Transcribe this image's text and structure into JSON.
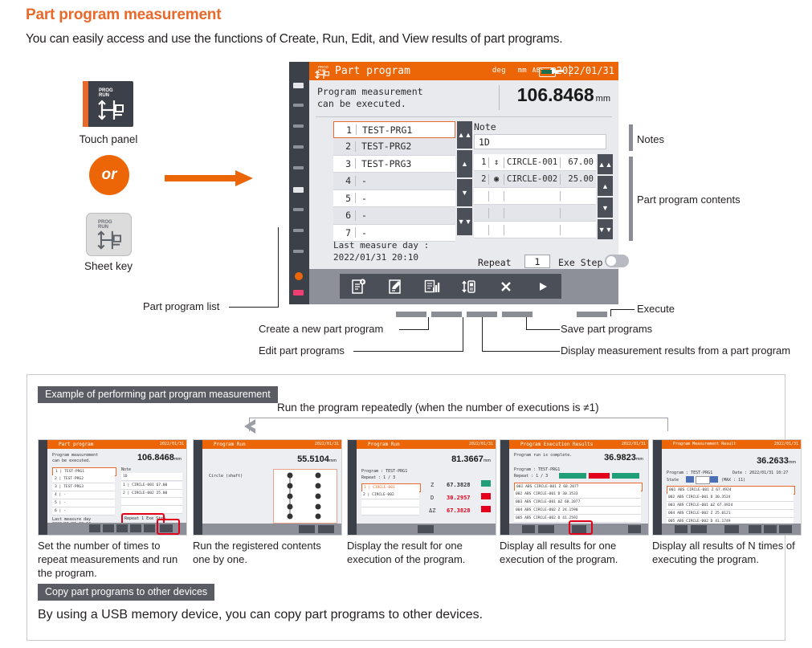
{
  "heading": "Part program measurement",
  "lead": "You can easily access and use the functions of Create, Run, Edit, and View results of part programs.",
  "left_column": {
    "touch_panel_label": "Touch panel",
    "or_label": "or",
    "sheet_key_label": "Sheet key",
    "icon_text_line1": "PROG",
    "icon_text_line2": "RUN"
  },
  "device": {
    "titlebar": {
      "title": "Part program",
      "status_deg": "deg",
      "status_mm": "mm",
      "status_abs": "ABS",
      "date": "2022/01/31"
    },
    "message_line1": "Program measurement",
    "message_line2": "can be executed.",
    "main_value": "106.8468",
    "main_unit": "mm",
    "program_list": [
      {
        "no": "1",
        "name": "TEST-PRG1"
      },
      {
        "no": "2",
        "name": "TEST-PRG2"
      },
      {
        "no": "3",
        "name": "TEST-PRG3"
      },
      {
        "no": "4",
        "name": "-"
      },
      {
        "no": "5",
        "name": "-"
      },
      {
        "no": "6",
        "name": "-"
      },
      {
        "no": "7",
        "name": "-"
      }
    ],
    "last_measure_label": "Last measure day  :",
    "last_measure_value": "2022/01/31 20:10",
    "note_label": "Note",
    "note_value": "1D",
    "contents": [
      {
        "no": "1",
        "name": "CIRCLE-001",
        "value": "67.00"
      },
      {
        "no": "2",
        "name": "CIRCLE-002",
        "value": "25.00"
      }
    ],
    "repeat_label": "Repeat",
    "repeat_value": "1",
    "exe_step_label": "Exe Step",
    "toolbar_icons": [
      "new-program-icon",
      "edit-program-icon",
      "results-icon",
      "usb-transfer-icon",
      "close-icon",
      "execute-icon"
    ]
  },
  "callouts": {
    "part_program_list": "Part program list",
    "create_new": "Create a new part program",
    "edit_programs": "Edit part programs",
    "notes": "Notes",
    "contents": "Part program contents",
    "execute": "Execute",
    "save": "Save part programs",
    "display_results": "Display measurement results from a part program"
  },
  "example": {
    "tag": "Example of performing part program measurement",
    "repeat_note": "Run the program repeatedly (when the number of executions is ≠1)",
    "steps": [
      {
        "title": "Part program",
        "value": "106.8468",
        "unit": "mm",
        "caption_line1": "Set the number of times to repeat",
        "caption_line2": "measurements and run the program.",
        "msg1": "Program measurement",
        "msg2": "can be executed."
      },
      {
        "title": "Program Run",
        "value": "55.5104",
        "unit": "mm",
        "caption_line1": "Run the registered contents",
        "caption_line2": "one by one.",
        "item": "Circle (shaft)"
      },
      {
        "title": "Program Run",
        "value": "81.3667",
        "unit": "mm",
        "caption_line1": "Display the result for one",
        "caption_line2": "execution of the program.",
        "program_label": "Program",
        "program_name": "TEST-PRG1",
        "repeat_label": "Repeat",
        "repeat_value": "1 / 3",
        "results": [
          {
            "axis": "Z",
            "value": "67.3828",
            "unit": "mm"
          },
          {
            "axis": "D",
            "value": "30.2957",
            "unit": "mm"
          },
          {
            "axis": "ΔZ",
            "value": "67.3828",
            "unit": "mm"
          }
        ]
      },
      {
        "title": "Program Execution Results",
        "value": "36.9823",
        "unit": "mm",
        "caption_line1": "Display all results for one",
        "caption_line2": "execution of the program.",
        "status": "Program run is complete.",
        "program_label": "Program",
        "program_name": "TEST-PRG1",
        "repeat_label": "Repeat",
        "repeat_value": "1 / 3",
        "rows": [
          {
            "no": "001",
            "abs": "ABS",
            "name": "CIRCLE-001",
            "axis": "Z",
            "value": "68.2077"
          },
          {
            "no": "002",
            "abs": "ABS",
            "name": "CIRCLE-001",
            "axis": "D",
            "value": "30.3533"
          },
          {
            "no": "003",
            "abs": "ABS",
            "name": "CIRCLE-001",
            "axis": "ΔZ",
            "value": "68.2077"
          },
          {
            "no": "004",
            "abs": "ABS",
            "name": "CIRCLE-002",
            "axis": "Z",
            "value": "24.1590"
          },
          {
            "no": "005",
            "abs": "ABS",
            "name": "CIRCLE-002",
            "axis": "D",
            "value": "41.2592"
          }
        ]
      },
      {
        "title": "Program Measurement Result",
        "value": "36.2633",
        "unit": "mm",
        "caption_line1": "Display all results of N times",
        "caption_line2": "of executing the program.",
        "program_label": "Program",
        "program_name": "TEST-PRG1",
        "date_label": "Date",
        "date_value": "2022/01/31 10:27",
        "state_label": "State",
        "state_value": "1",
        "max_label": "(MAX : 11)",
        "rows": [
          {
            "no": "001",
            "abs": "ABS",
            "name": "CIRCLE-001",
            "axis": "Z",
            "value": "67.4924"
          },
          {
            "no": "002",
            "abs": "ABS",
            "name": "CIRCLE-001",
            "axis": "D",
            "value": "30.3524"
          },
          {
            "no": "003",
            "abs": "ABS",
            "name": "CIRCLE-001",
            "axis": "ΔZ",
            "value": "67.4924"
          },
          {
            "no": "004",
            "abs": "ABS",
            "name": "CIRCLE-002",
            "axis": "Z",
            "value": "25.0121"
          },
          {
            "no": "005",
            "abs": "ABS",
            "name": "CIRCLE-002",
            "axis": "D",
            "value": "41.1749"
          }
        ]
      }
    ]
  },
  "copy_section": {
    "tag": "Copy part programs to other devices",
    "text": "By using a USB memory device, you can copy part programs to other devices."
  },
  "colors": {
    "accent_orange": "#ec6608",
    "heading_orange": "#e8692a",
    "bezel_dark": "#3c4049",
    "highlight_red": "#e2001a"
  }
}
